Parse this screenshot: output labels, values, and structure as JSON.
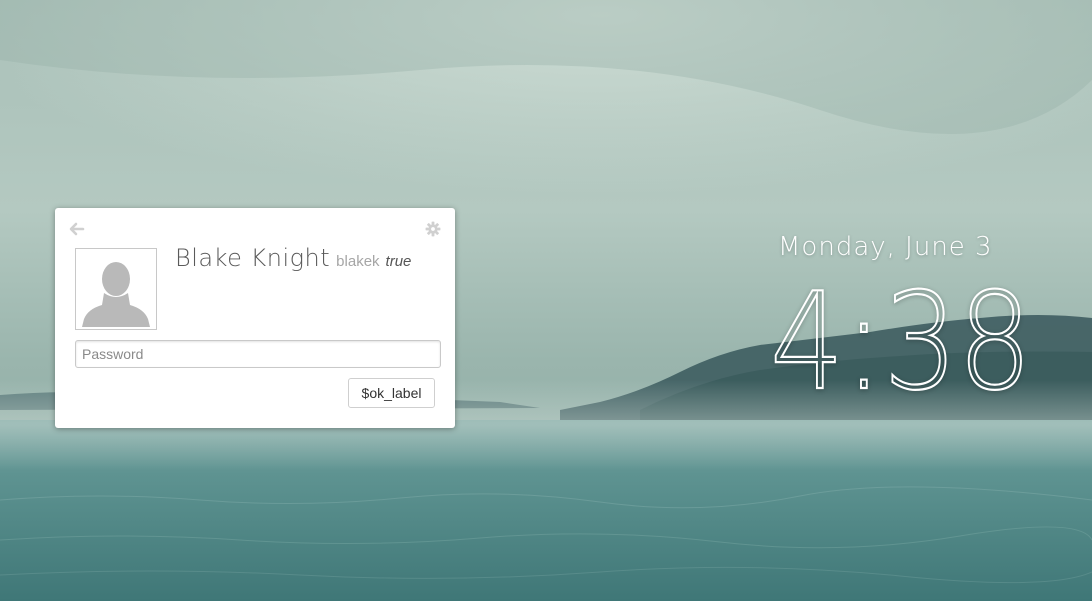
{
  "login": {
    "back_icon": "arrow-left-icon",
    "settings_icon": "gear-icon",
    "avatar_icon": "default-user-avatar-icon",
    "full_name": "Blake Knight",
    "username": "blakek",
    "session": "true",
    "password_placeholder": "Password",
    "password_value": "",
    "ok_label": "$ok_label"
  },
  "clock": {
    "date": "Monday, June 3",
    "time": "4:38"
  },
  "colors": {
    "card_bg": "#ffffff",
    "text_primary": "#5a5a5a",
    "text_muted": "#a6a6a6",
    "clock_text": "#ffffff"
  }
}
